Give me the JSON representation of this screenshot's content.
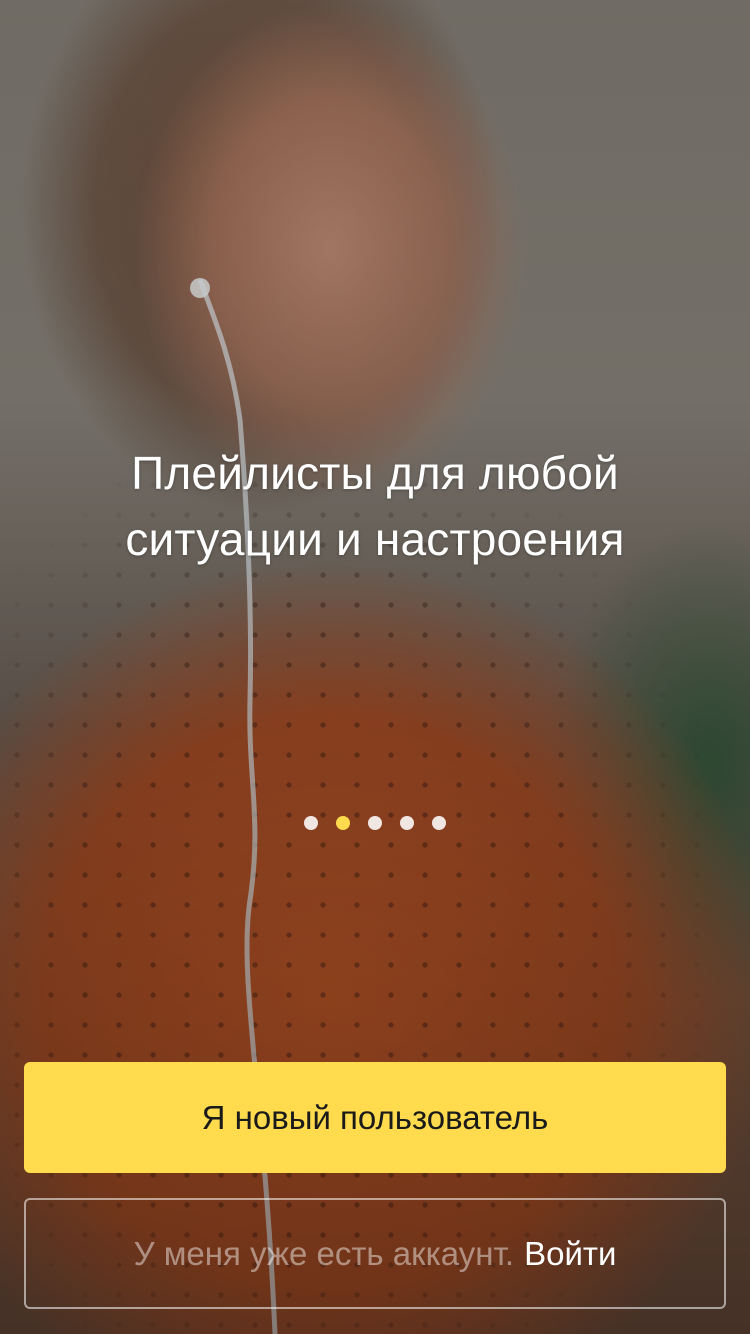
{
  "onboarding": {
    "headline_line1": "Плейлисты для любой",
    "headline_line2": "ситуации и настроения",
    "pager": {
      "total": 5,
      "active_index": 1
    },
    "new_user_button_label": "Я новый пользователь",
    "have_account_text": "У меня уже есть аккаунт.",
    "login_link_label": "Войти"
  },
  "colors": {
    "accent": "#ffdb4d",
    "headline_text": "#ffffff"
  }
}
